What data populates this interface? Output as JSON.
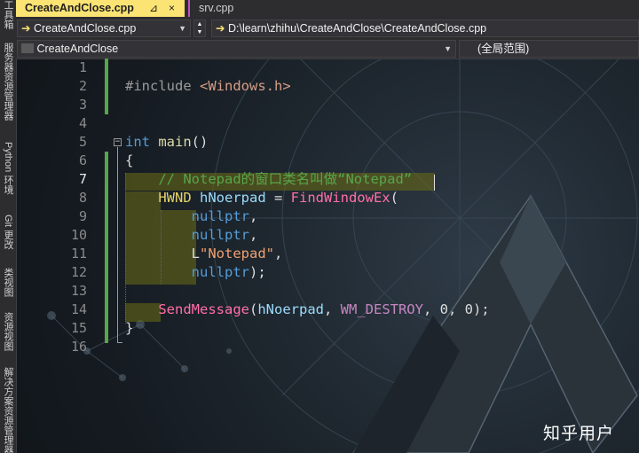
{
  "left_toolbar": {
    "items": [
      {
        "label": "工具箱"
      },
      {
        "label": "服务器资源管理器"
      },
      {
        "label": "Python 环境"
      },
      {
        "label": "Git 更改"
      },
      {
        "label": "类视图"
      },
      {
        "label": "资源视图"
      },
      {
        "label": "解决方案资源管理器"
      }
    ]
  },
  "tabs": [
    {
      "label": "CreateAndClose.cpp",
      "pin": "⊿",
      "close": "×"
    },
    {
      "label": "srv.cpp"
    }
  ],
  "nav": {
    "file_combo": "CreateAndClose.cpp",
    "path": "D:\\learn\\zhihu\\CreateAndClose\\CreateAndClose.cpp",
    "project_combo": "CreateAndClose",
    "scope_combo": "(全局范围)"
  },
  "editor": {
    "current_line": 7,
    "line_numbers": [
      "1",
      "2",
      "3",
      "4",
      "5",
      "6",
      "7",
      "8",
      "9",
      "10",
      "11",
      "12",
      "13",
      "14",
      "15",
      "16"
    ],
    "lines": [
      [],
      [
        {
          "t": "#include ",
          "c": "pp"
        },
        {
          "t": "<Windows.h>",
          "c": "inc"
        }
      ],
      [],
      [],
      [
        {
          "t": "int",
          "c": "kw"
        },
        {
          "t": " "
        },
        {
          "t": "main",
          "c": "fn"
        },
        {
          "t": "()"
        }
      ],
      [
        {
          "t": "{"
        }
      ],
      [
        {
          "t": "    "
        },
        {
          "t": "// Notepad的窗口类名叫做“Notepad”",
          "c": "cmt"
        }
      ],
      [
        {
          "t": "    "
        },
        {
          "t": "HWND",
          "c": "typ"
        },
        {
          "t": " "
        },
        {
          "t": "hNoerpad",
          "c": "var"
        },
        {
          "t": " = "
        },
        {
          "t": "FindWindowEx",
          "c": "fnp"
        },
        {
          "t": "("
        }
      ],
      [
        {
          "t": "        "
        },
        {
          "t": "nullptr",
          "c": "kw"
        },
        {
          "t": ","
        }
      ],
      [
        {
          "t": "        "
        },
        {
          "t": "nullptr",
          "c": "kw"
        },
        {
          "t": ","
        }
      ],
      [
        {
          "t": "        L"
        },
        {
          "t": "\"Notepad\"",
          "c": "str"
        },
        {
          "t": ","
        }
      ],
      [
        {
          "t": "        "
        },
        {
          "t": "nullptr",
          "c": "kw"
        },
        {
          "t": ");"
        }
      ],
      [],
      [
        {
          "t": "    "
        },
        {
          "t": "SendMessage",
          "c": "fnp"
        },
        {
          "t": "("
        },
        {
          "t": "hNoerpad",
          "c": "var"
        },
        {
          "t": ", "
        },
        {
          "t": "WM_DESTROY",
          "c": "mac"
        },
        {
          "t": ", 0, 0);"
        }
      ],
      [
        {
          "t": "}"
        }
      ],
      []
    ]
  },
  "watermark": "知乎用户",
  "colors": {
    "active_tab": "#fce474",
    "change_bar": "#57a64a",
    "comment": "#57a64a",
    "keyword": "#569cd6",
    "function": "#ff6fa6",
    "macro": "#c586c0",
    "string": "#f0a070"
  }
}
